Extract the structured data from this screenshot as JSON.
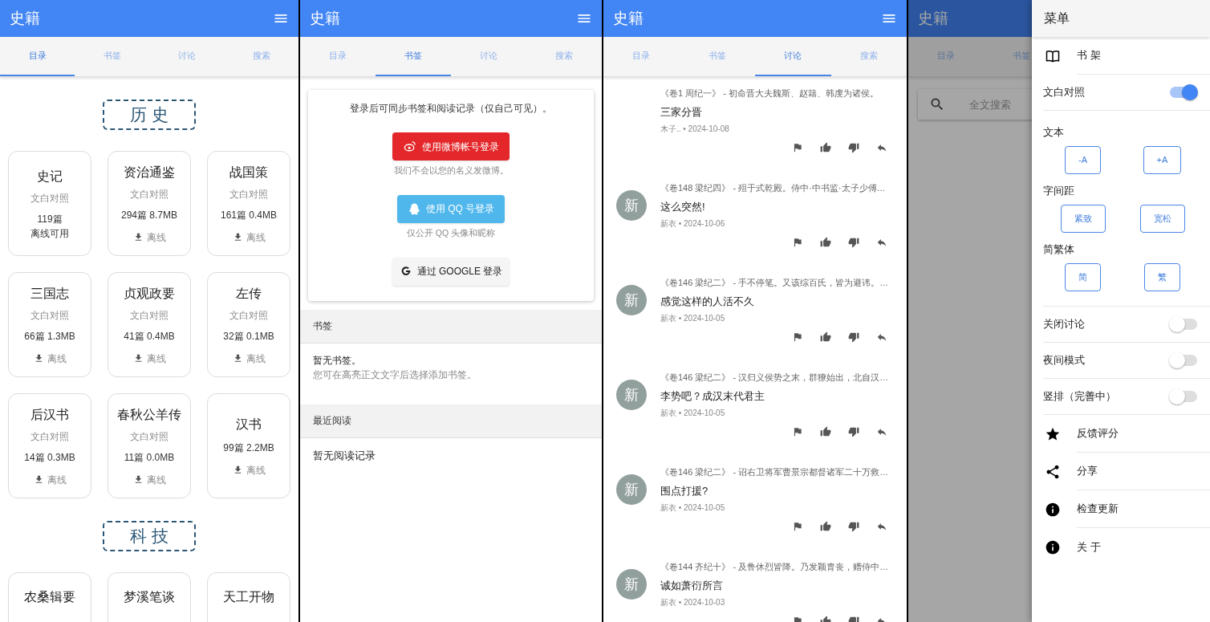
{
  "screens": [
    {
      "kind": "catalog",
      "app_bar": {
        "title": "史籍"
      },
      "tabs": [
        {
          "label": "目录",
          "selected": true
        },
        {
          "label": "书签",
          "selected": false
        },
        {
          "label": "讨论",
          "selected": false
        },
        {
          "label": "搜索",
          "selected": false
        }
      ],
      "sections": [
        {
          "title": "历 史",
          "books": [
            {
              "title": "史记",
              "subtitle": "文白对照",
              "stats": "119篇",
              "status": "离线可用"
            },
            {
              "title": "资治通鉴",
              "subtitle": "文白对照",
              "stats": "294篇 8.7MB",
              "download": "离线"
            },
            {
              "title": "战国策",
              "subtitle": "文白对照",
              "stats": "161篇 0.4MB",
              "download": "离线"
            },
            {
              "title": "三国志",
              "subtitle": "文白对照",
              "stats": "66篇 1.3MB",
              "download": "离线"
            },
            {
              "title": "贞观政要",
              "subtitle": "文白对照",
              "stats": "41篇 0.4MB",
              "download": "离线"
            },
            {
              "title": "左传",
              "subtitle": "文白对照",
              "stats": "32篇 0.1MB",
              "download": "离线"
            },
            {
              "title": "后汉书",
              "subtitle": "文白对照",
              "stats": "14篇 0.3MB",
              "download": "离线"
            },
            {
              "title": "春秋公羊传",
              "subtitle": "文白对照",
              "stats": "11篇 0.0MB",
              "download": "离线"
            },
            {
              "title": "汉书",
              "stats": "99篇 2.2MB",
              "download": "离线"
            }
          ]
        },
        {
          "title": "科 技",
          "books": [
            {
              "title": "农桑辑要"
            },
            {
              "title": "梦溪笔谈"
            },
            {
              "title": "天工开物"
            }
          ]
        }
      ]
    },
    {
      "kind": "bookmarks",
      "app_bar": {
        "title": "史籍"
      },
      "tabs": [
        {
          "label": "目录",
          "selected": false
        },
        {
          "label": "书签",
          "selected": true
        },
        {
          "label": "讨论",
          "selected": false
        },
        {
          "label": "搜索",
          "selected": false
        }
      ],
      "login": {
        "intro": "登录后可同步书签和阅读记录（仅自己可见）。",
        "buttons": [
          {
            "kind": "weibo",
            "label": "使用微博帐号登录",
            "note": "我们不会以您的名义发微博。"
          },
          {
            "kind": "qq",
            "label": "使用 QQ 号登录",
            "note": "仅公开 QQ 头像和昵称"
          },
          {
            "kind": "google",
            "label": "通过 GOOGLE 登录"
          }
        ]
      },
      "lists": [
        {
          "header": "书签",
          "empty": "暂无书签。",
          "hint": "您可在高亮正文文字后选择添加书签。"
        },
        {
          "header": "最近阅读",
          "empty": "暂无阅读记录"
        }
      ]
    },
    {
      "kind": "discussion",
      "app_bar": {
        "title": "史籍"
      },
      "tabs": [
        {
          "label": "目录",
          "selected": false
        },
        {
          "label": "书签",
          "selected": false
        },
        {
          "label": "讨论",
          "selected": true
        },
        {
          "label": "搜索",
          "selected": false
        }
      ],
      "comments": [
        {
          "source": "《卷1 周纪一》 - 初命晋大夫魏斯、赵籍、韩虔为诸侯。",
          "text": "三家分晋",
          "meta": "木子.. • 2024-10-08"
        },
        {
          "avatar": "新",
          "source": "《卷148 梁纪四》 - 殂于式乾殿。侍中·中书监·太子少傅…",
          "text": "这么突然!",
          "meta": "新衣 • 2024-10-06"
        },
        {
          "avatar": "新",
          "source": "《卷146 梁纪二》 - 手不停笔。又该综百氏，皆为避讳。…",
          "text": "感觉这样的人活不久",
          "meta": "新衣 • 2024-10-05"
        },
        {
          "avatar": "新",
          "source": "《卷146 梁纪二》 - 汉归义侯势之末，群獠始出，北自汉…",
          "text": "李势吧？成汉末代君主",
          "meta": "新衣 • 2024-10-05"
        },
        {
          "avatar": "新",
          "source": "《卷146 梁纪二》 - 诏右卫将军曹景宗都督诸军二十万救…",
          "text": "围点打援?",
          "meta": "新衣 • 2024-10-05"
        },
        {
          "avatar": "新",
          "source": "《卷144 齐纪十》 - 及鲁休烈皆降。乃发颖胄丧，赠侍中…",
          "text": "诚如萧衍所言",
          "meta": "新衣 • 2024-10-03"
        }
      ]
    },
    {
      "kind": "menu",
      "app_bar": {
        "title": "史籍"
      },
      "tabs": [
        {
          "label": "目录",
          "selected": false
        },
        {
          "label": "书签",
          "selected": false
        }
      ],
      "search": {
        "placeholder": "全文搜索"
      },
      "drawer": {
        "title": "菜单",
        "items": [
          {
            "kind": "link",
            "label": "书 架"
          },
          {
            "kind": "switch",
            "label": "文白对照",
            "on": true
          },
          {
            "kind": "buttons",
            "label": "文本",
            "buttons": [
              "-A",
              "+A"
            ]
          },
          {
            "kind": "buttons",
            "label": "字间距",
            "buttons": [
              "紧致",
              "宽松"
            ]
          },
          {
            "kind": "buttons",
            "label": "简繁体",
            "buttons": [
              "简",
              "繁"
            ]
          },
          {
            "kind": "switch",
            "label": "关闭讨论",
            "on": false
          },
          {
            "kind": "switch",
            "label": "夜间模式",
            "on": false
          },
          {
            "kind": "switch",
            "label": "竖排（完善中）",
            "on": false
          },
          {
            "kind": "link",
            "label": "反馈评分"
          },
          {
            "kind": "link",
            "label": "分享"
          },
          {
            "kind": "link",
            "label": "检查更新"
          },
          {
            "kind": "link",
            "label": "关 于"
          }
        ]
      }
    }
  ]
}
